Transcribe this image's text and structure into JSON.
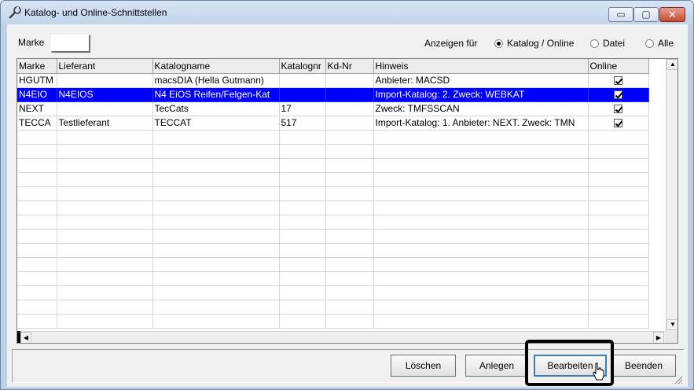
{
  "window": {
    "title": "Katalog- und Online-Schnittstellen",
    "controls": {
      "minimize": "▭",
      "maximize": "▢",
      "close": "✕"
    }
  },
  "filter": {
    "marke_label": "Marke",
    "marke_value": "",
    "anzeigen_label": "Anzeigen für",
    "options": [
      {
        "label": "Katalog / Online",
        "selected": true
      },
      {
        "label": "Datei",
        "selected": false
      },
      {
        "label": "Alle",
        "selected": false
      }
    ]
  },
  "table": {
    "columns": [
      "Marke",
      "Lieferant",
      "Katalogname",
      "Katalognr",
      "Kd-Nr",
      "Hinweis",
      "Online"
    ],
    "rows": [
      {
        "marke": "HGUTM",
        "lieferant": "",
        "katalogname": "macsDIA (Hella Gutmann)",
        "katalognr": "",
        "kdnr": "",
        "hinweis": "Anbieter: MACSD",
        "online": true,
        "selected": false
      },
      {
        "marke": "N4EIO",
        "lieferant": "N4EIOS",
        "katalogname": "N4 EiOS Reifen/Felgen-Kat",
        "katalognr": "",
        "kdnr": "",
        "hinweis": "Import-Katalog: 2. Zweck: WEBKAT",
        "online": true,
        "selected": true
      },
      {
        "marke": "NEXT",
        "lieferant": "",
        "katalogname": "TecCats",
        "katalognr": "17",
        "kdnr": "",
        "hinweis": "Zweck: TMFSSCAN",
        "online": true,
        "selected": false
      },
      {
        "marke": "TECCA",
        "lieferant": "Testlieferant",
        "katalogname": "TECCAT",
        "katalognr": "517",
        "kdnr": "",
        "hinweis": "Import-Katalog: 1. Anbieter: NEXT. Zweck: TMN",
        "online": true,
        "selected": false
      }
    ]
  },
  "buttons": {
    "loeschen": "Löschen",
    "anlegen": "Anlegen",
    "bearbeiten": "Bearbeiten",
    "beenden": "Beenden"
  },
  "colors": {
    "selection": "#0000ff",
    "titlebar": "#c3d4ea",
    "close_button": "#c84a30"
  }
}
